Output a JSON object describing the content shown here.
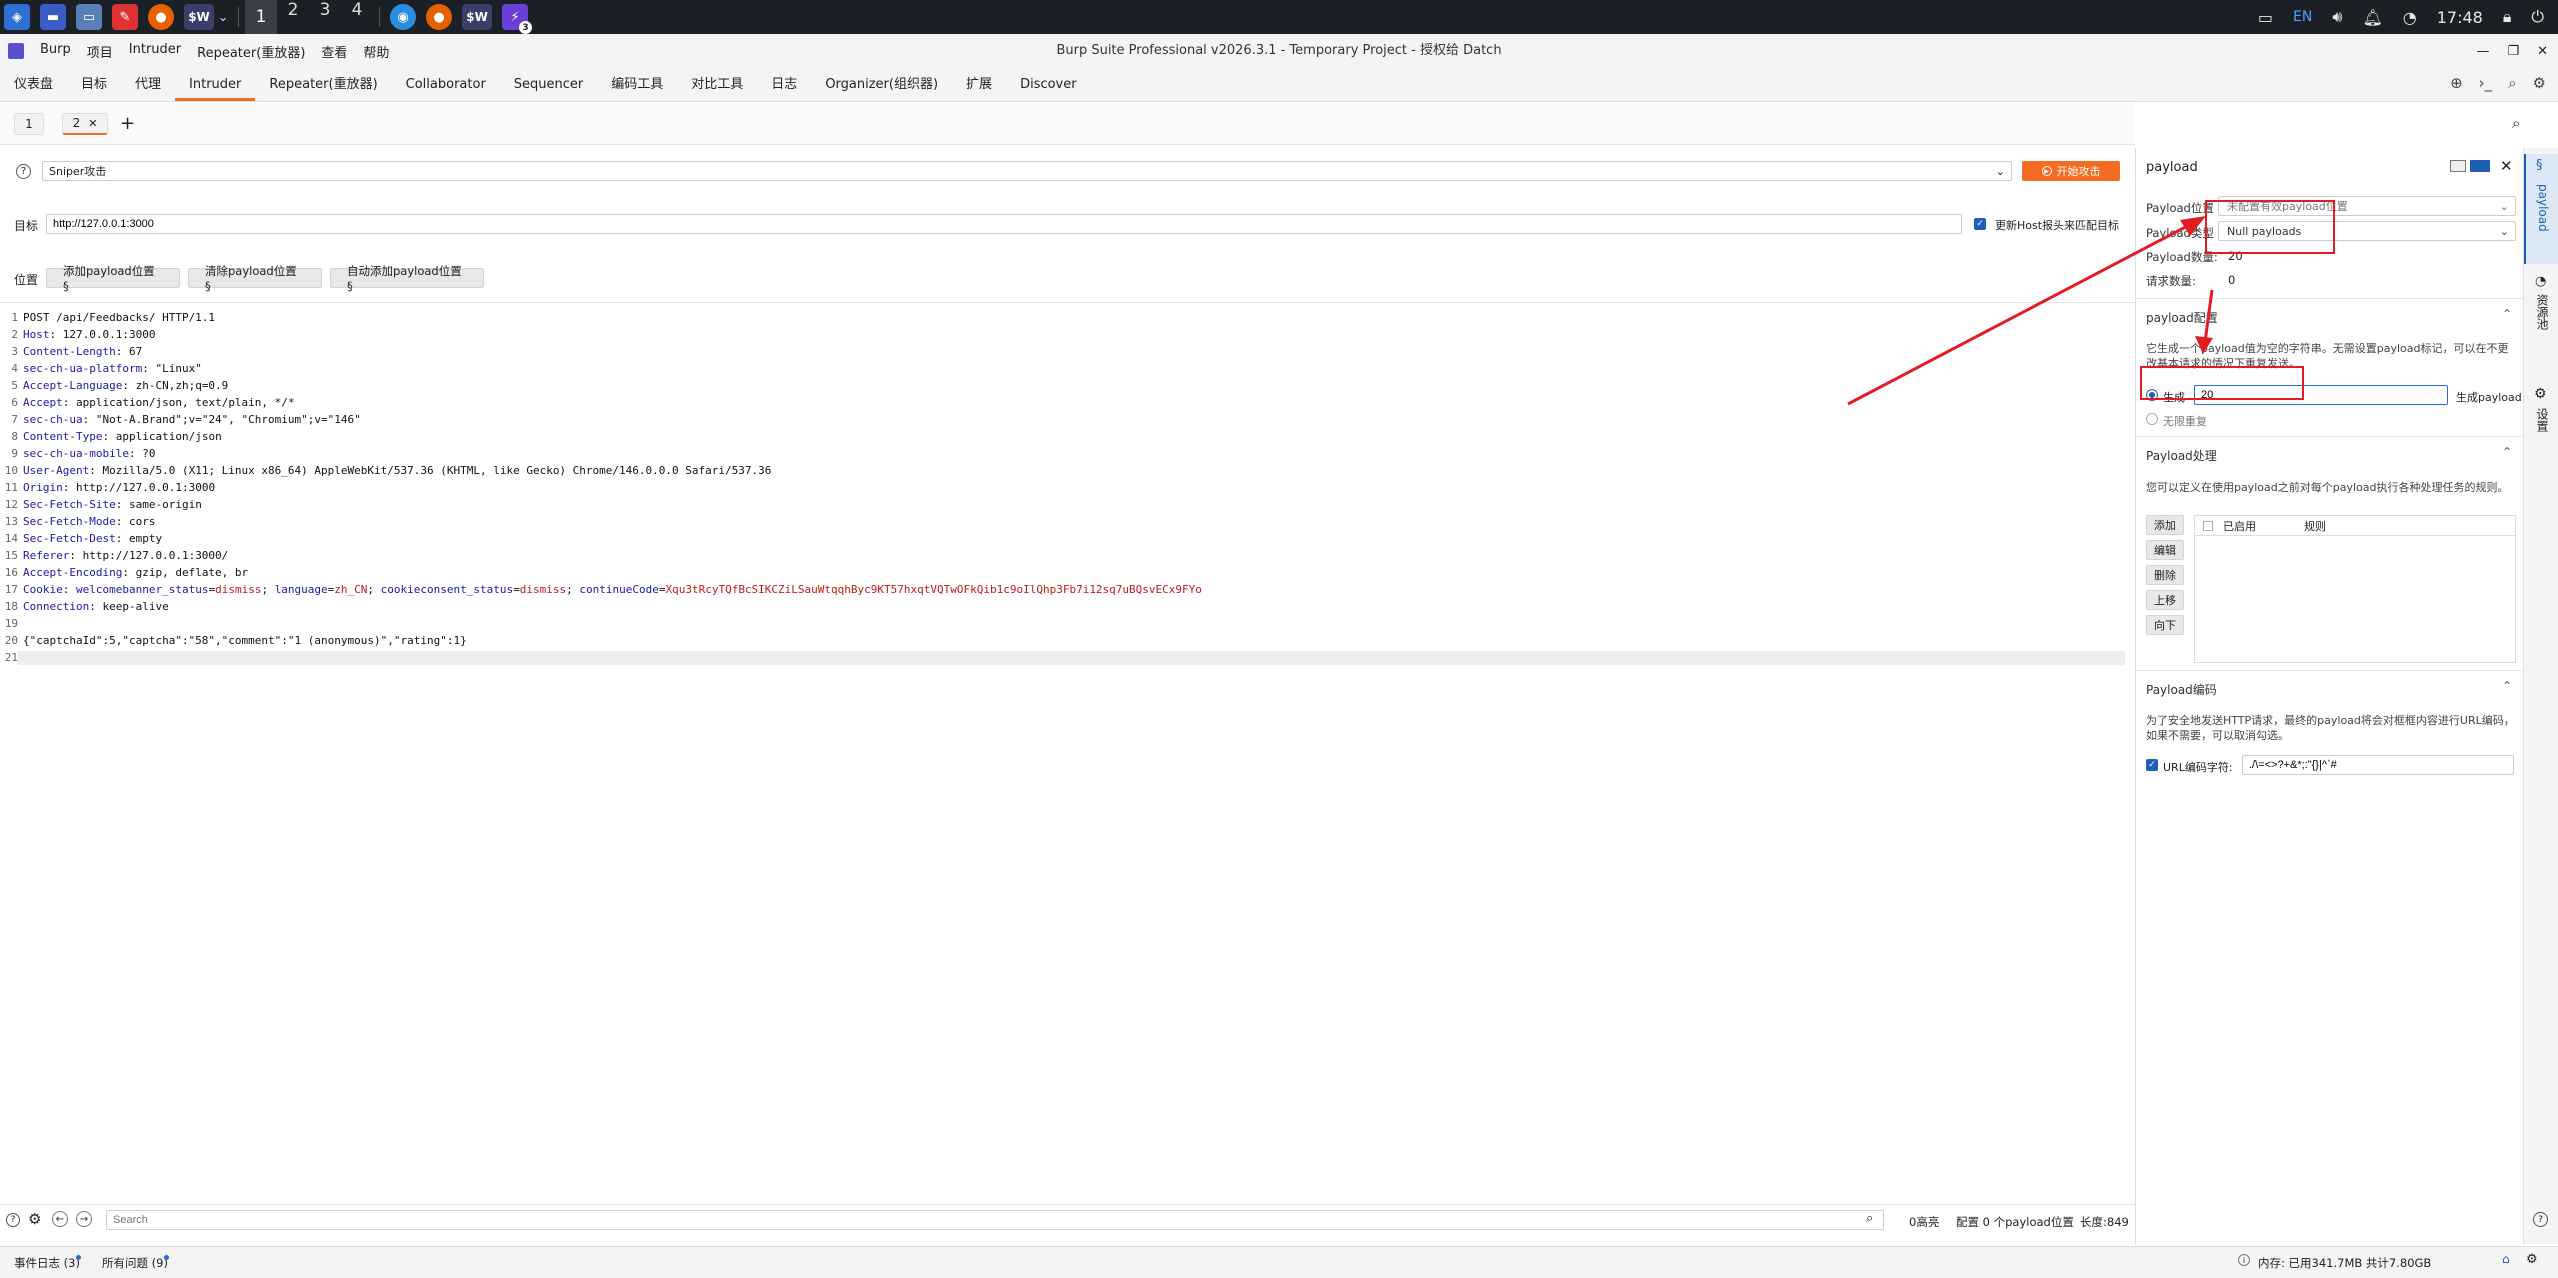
{
  "taskbar": {
    "workspaces": [
      "1",
      "2",
      "3",
      "4"
    ],
    "active_workspace": "1",
    "badge": "3",
    "lang": "EN",
    "time": "17:48",
    "app_label": "$W"
  },
  "menubar": {
    "items": [
      "Burp",
      "项目",
      "Intruder",
      "Repeater(重放器)",
      "查看",
      "帮助"
    ],
    "title": "Burp Suite Professional v2026.3.1 - Temporary Project - 授权给 Datch"
  },
  "main_tabs": [
    "仪表盘",
    "目标",
    "代理",
    "Intruder",
    "Repeater(重放器)",
    "Collaborator",
    "Sequencer",
    "编码工具",
    "对比工具",
    "日志",
    "Organizer(组织器)",
    "扩展",
    "Discover"
  ],
  "active_tab": "Intruder",
  "sub_tabs": [
    "1",
    "2"
  ],
  "attack": {
    "mode": "Sniper攻击",
    "start_label": "开始攻击"
  },
  "target": {
    "label": "目标",
    "url": "http://127.0.0.1:3000",
    "update_host_label": "更新Host报头来匹配目标"
  },
  "positions": {
    "label": "位置",
    "add": "添加payload位置 §",
    "clear": "清除payload位置 §",
    "auto": "自动添加payload位置 §"
  },
  "request_lines": [
    [
      [
        "POST /api/Feedbacks/ HTTP/1.1",
        "hv"
      ]
    ],
    [
      [
        "Host",
        "hk"
      ],
      [
        ": 127.0.0.1:3000",
        "hv"
      ]
    ],
    [
      [
        "Content-Length",
        "hk"
      ],
      [
        ": 67",
        "hv"
      ]
    ],
    [
      [
        "sec-ch-ua-platform",
        "hk"
      ],
      [
        ": \"Linux\"",
        "hv"
      ]
    ],
    [
      [
        "Accept-Language",
        "hk"
      ],
      [
        ": zh-CN,zh;q=0.9",
        "hv"
      ]
    ],
    [
      [
        "Accept",
        "hk"
      ],
      [
        ": application/json, text/plain, */*",
        "hv"
      ]
    ],
    [
      [
        "sec-ch-ua",
        "hk"
      ],
      [
        ": \"Not-A.Brand\";v=\"24\", \"Chromium\";v=\"146\"",
        "hv"
      ]
    ],
    [
      [
        "Content-Type",
        "hk"
      ],
      [
        ": application/json",
        "hv"
      ]
    ],
    [
      [
        "sec-ch-ua-mobile",
        "hk"
      ],
      [
        ": ?0",
        "hv"
      ]
    ],
    [
      [
        "User-Agent",
        "hk"
      ],
      [
        ": Mozilla/5.0 (X11; Linux x86_64) AppleWebKit/537.36 (KHTML, like Gecko) Chrome/146.0.0.0 Safari/537.36",
        "hv"
      ]
    ],
    [
      [
        "Origin",
        "hk"
      ],
      [
        ": http://127.0.0.1:3000",
        "hv"
      ]
    ],
    [
      [
        "Sec-Fetch-Site",
        "hk"
      ],
      [
        ": same-origin",
        "hv"
      ]
    ],
    [
      [
        "Sec-Fetch-Mode",
        "hk"
      ],
      [
        ": cors",
        "hv"
      ]
    ],
    [
      [
        "Sec-Fetch-Dest",
        "hk"
      ],
      [
        ": empty",
        "hv"
      ]
    ],
    [
      [
        "Referer",
        "hk"
      ],
      [
        ": http://127.0.0.1:3000/",
        "hv"
      ]
    ],
    [
      [
        "Accept-Encoding",
        "hk"
      ],
      [
        ": gzip, deflate, br",
        "hv"
      ]
    ],
    [
      [
        "Cookie",
        "hk"
      ],
      [
        ": ",
        "hv"
      ],
      [
        "welcomebanner_status",
        "ck"
      ],
      [
        "=",
        "hv"
      ],
      [
        "dismiss",
        "cv"
      ],
      [
        "; ",
        "hv"
      ],
      [
        "language",
        "ck"
      ],
      [
        "=",
        "hv"
      ],
      [
        "zh_CN",
        "cv"
      ],
      [
        "; ",
        "hv"
      ],
      [
        "cookieconsent_status",
        "ck"
      ],
      [
        "=",
        "hv"
      ],
      [
        "dismiss",
        "cv"
      ],
      [
        "; ",
        "hv"
      ],
      [
        "continueCode",
        "ck"
      ],
      [
        "=",
        "hv"
      ],
      [
        "Xqu3tRcyTQfBcSIKCZiLSauWtqqhByc9KT57hxqtVQTwOFkQib1c9oIlQhp3Fb7i12sq7uBQsvECx9FYo",
        "cv"
      ]
    ],
    [
      [
        "Connection",
        "hk"
      ],
      [
        ": keep-alive",
        "hv"
      ]
    ],
    [
      [
        "",
        "hv"
      ]
    ],
    [
      [
        "{\"captchaId\":5,\"captcha\":\"58\",\"comment\":\"1 (anonymous)\",\"rating\":1}",
        "hv"
      ]
    ],
    [
      [
        "",
        "hv"
      ]
    ]
  ],
  "search": {
    "placeholder": "Search",
    "highlights": "0高亮",
    "config": "配置 0 个payload位置",
    "length": "长度:849"
  },
  "status": {
    "event_log": "事件日志 (3)",
    "issues": "所有问题 (9)",
    "memory": "内存: 已用341.7MB 共计7.80GB"
  },
  "payload_panel": {
    "title": "payload",
    "position_label": "Payload位置",
    "position_value": "未配置有效payload位置",
    "type_label": "Payload类型",
    "type_value": "Null payloads",
    "count_label": "Payload数量:",
    "count_value": "20",
    "request_count_label": "请求数量:",
    "request_count_value": "0",
    "config_title": "payload配置",
    "config_desc": "它生成一个payload值为空的字符串。无需设置payload标记，可以在不更改基本请求的情况下重复发送。",
    "generate_label": "生成",
    "generate_value": "20",
    "generate_suffix": "生成payload",
    "infinite_label": "无限重复",
    "processing_title": "Payload处理",
    "processing_desc": "您可以定义在使用payload之前对每个payload执行各种处理任务的规则。",
    "proc_buttons": [
      "添加",
      "编辑",
      "删除",
      "上移",
      "向下"
    ],
    "proc_cols": [
      "已启用",
      "规则"
    ],
    "encoding_title": "Payload编码",
    "encoding_desc": "为了安全地发送HTTP请求，最终的payload将会对框框内容进行URL编码，如果不需要，可以取消勾选。",
    "url_encode_label": "URL编码字符:",
    "url_encode_chars": "./\\=<>?+&*;:\"{}|^`#"
  },
  "side_tabs": [
    "payload",
    "资源池",
    "设置"
  ],
  "colors": {
    "accent": "#f36c21",
    "annotation": "#e31b23",
    "taskbar": "#1b2027"
  }
}
